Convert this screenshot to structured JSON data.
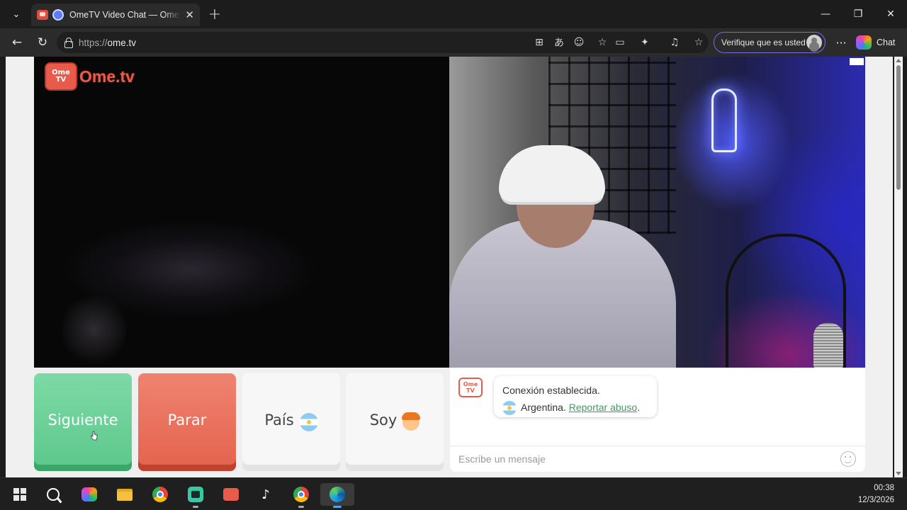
{
  "browser": {
    "tab": {
      "title": "OmeTV Video Chat — Omegle",
      "close_glyph": "✕"
    },
    "new_tab_glyph": "+",
    "window_controls": {
      "minimize": "—",
      "maximize": "❐",
      "close": "✕"
    },
    "address": {
      "protocol": "https://",
      "host": "ome.tv"
    },
    "profile_button": "Verifique que es usted",
    "more_glyph": "···",
    "chat_button": "Chat"
  },
  "page": {
    "logo": {
      "tv_line1": "Ome",
      "tv_line2": "TV",
      "word": "Ome.tv"
    },
    "controls": {
      "next": "Siguiente",
      "stop": "Parar",
      "country": "País",
      "gender": "Soy"
    },
    "chat": {
      "bot_logo": {
        "line1": "Ome",
        "line2": "TV"
      },
      "message_line1": "Conexión establecida.",
      "country": "Argentina.",
      "report_link": "Reportar abuso",
      "report_suffix": ".",
      "input_placeholder": "Escribe un mensaje"
    }
  },
  "taskbar": {
    "time": "00:38",
    "date": "12/3/2026"
  },
  "colors": {
    "accent_green": "#5cc88b",
    "accent_red": "#e4624d",
    "brand": "#e85b4a"
  }
}
